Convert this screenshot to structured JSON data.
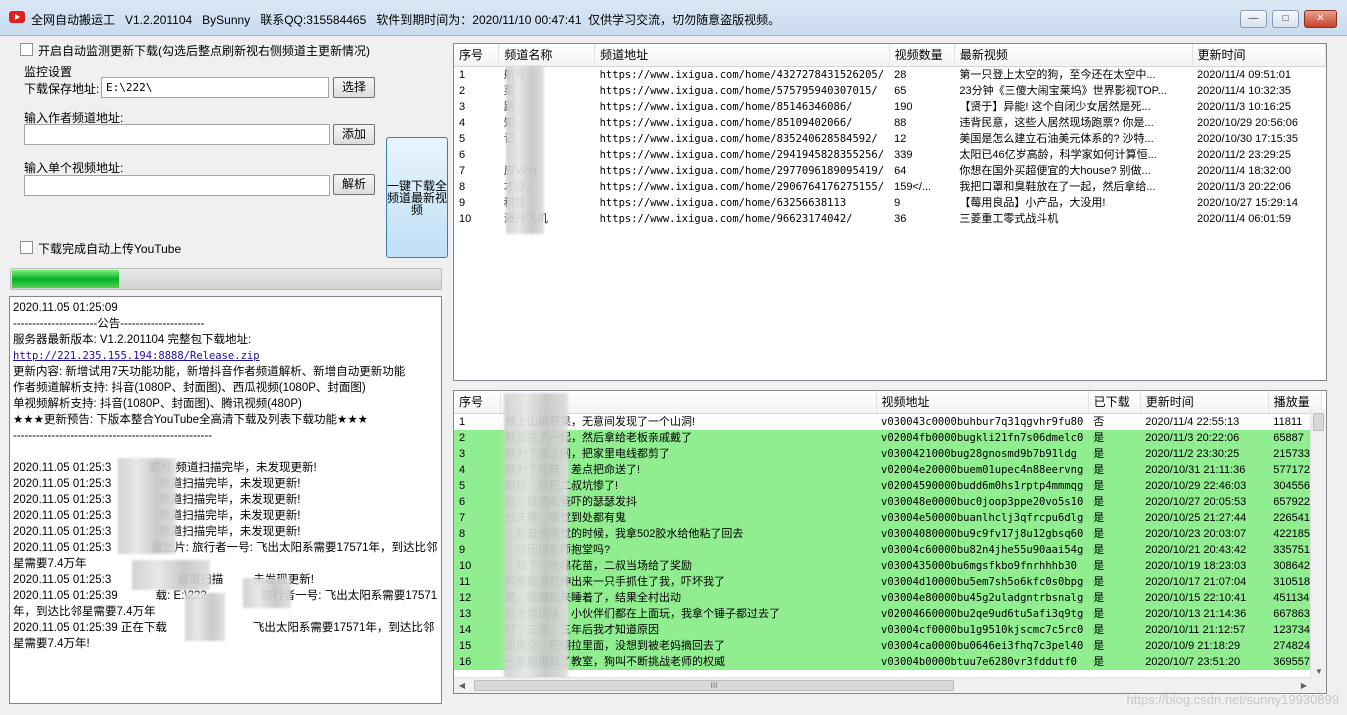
{
  "window": {
    "title": "全网自动搬运工   V1.2.201104   BySunny   联系QQ:315584465   软件到期时间为：2020/11/10 00:47:41  仅供学习交流，切勿随意盗版视频。",
    "minimize": "—",
    "maximize": "□",
    "close": "✕"
  },
  "left": {
    "auto_monitor_label": "开启自动监测更新下载(勾选后整点刷新视右侧频道主更新情况)",
    "auto_monitor_checked": false,
    "monitor_settings": "监控设置",
    "save_path_label": "下载保存地址:",
    "save_path_value": "E:\\222\\",
    "choose_button": "选择",
    "author_channel_label": "输入作者频道地址:",
    "author_channel_value": "",
    "add_button": "添加",
    "single_video_label": "输入单个视频地址:",
    "single_video_value": "",
    "parse_button": "解析",
    "download_all_button": "一键下载全频道最新视频",
    "auto_upload_label": "下载完成自动上传YouTube",
    "auto_upload_checked": false,
    "progress": 0.25,
    "colors": {
      "progress": "#06b025",
      "row_highlight": "#90ee90",
      "link": "#1a0dab"
    }
  },
  "log": {
    "line1": "2020.11.05 01:25:09",
    "line2": "----------------------公告----------------------",
    "line3": "服务器最新版本: V1.2.201104 完整包下载地址:",
    "link": "http://221.235.155.194:8888/Release.zip",
    "line5": "更新内容: 新增试用7天功能功能，新增抖音作者频道解析、新增自动更新功能",
    "line6": "作者频道解析支持: 抖音(1080P、封面图)、西瓜视频(1080P、封面图)",
    "line7": "单视频解析支持: 抖音(1080P、封面图)、腾讯视频(480P)",
    "line8": "★★★更新预告: 下版本整合YouTube全高清下载及列表下载功能★★★",
    "line9": "----------------------------------------------------",
    "e1": "2020.11.05 01:25:3",
    "e1b": "航号 频道扫描完毕，未发现更新!",
    "e2": "2020.11.05 01:25:3",
    "e2b": "频道扫描完毕，未发现更新!",
    "e3": "2020.11.05 01:25:3",
    "e3b": "频道扫描完毕，未发现更新!",
    "e4": "2020.11.05 01:25:3",
    "e4b": "频道扫描完毕，未发现更新!",
    "e5": "2020.11.05 01:25:3",
    "e5b": "频道扫描完毕，未发现更新!",
    "e6": "2020.11.05 01:25:3",
    "e6b": "截图片: 旅行者一号: 飞出太阳系需要17571年，到达比邻星需要7.4万年",
    "e7": "2020.11.05 01:25:3",
    "e7b": "频道扫描",
    "e7c": "未发现更新!",
    "e8": "2020.11.05 01:25:39",
    "e8b": "载: E:\\222",
    "e8c": "旅行者一号: 飞出太阳系需要17571年，到达比邻星需要7.4万年",
    "e9": "2020.11.05 01:25:39 正在下载",
    "e9b": "飞出太阳系需要17571年，到达比邻星需要7.4万年!"
  },
  "channels": {
    "headers": [
      "序号",
      "频道名称",
      "频道地址",
      "视频数量",
      "最新视频",
      "更新时间"
    ],
    "rows": [
      [
        "1",
        "航号",
        "https://www.ixigua.com/home/4327278431526205/",
        "28",
        "第一只登上太空的狗，至今还在太空中...",
        "2020/11/4 09:51:01"
      ],
      [
        "2",
        "菜",
        "https://www.ixigua.com/home/575795940307015/",
        "65",
        "23分钟《三傻大闹宝莱坞》世界影视TOP...",
        "2020/11/4 10:32:35"
      ],
      [
        "3",
        "路",
        "https://www.ixigua.com/home/85146346086/",
        "190",
        "【贤于】异能! 这个自闭少女居然是死...",
        "2020/11/3 10:16:25"
      ],
      [
        "4",
        "知",
        "https://www.ixigua.com/home/85109402066/",
        "88",
        "违背民意，这些人居然现场跑票? 你是...",
        "2020/10/29 20:56:06"
      ],
      [
        "5",
        "记",
        "https://www.ixigua.com/home/835240628584592/",
        "12",
        "美国是怎么建立石油美元体系的? 沙特...",
        "2020/10/30 17:15:35"
      ],
      [
        "6",
        "",
        "https://www.ixigua.com/home/2941945828355256/",
        "339",
        "太阳已46亿岁高龄，科学家如何计算恒...",
        "2020/11/2 23:29:25"
      ],
      [
        "7",
        "房Vlog",
        "https://www.ixigua.com/home/2977096189095419/",
        "64",
        "你想在国外买超便宜的大house? 别做...",
        "2020/11/4 18:32:00"
      ],
      [
        "8",
        "才沙...",
        "https://www.ixigua.com/home/2906764176275155/",
        "159</...",
        "我把口罩和臭鞋放在了一起，然后拿给...",
        "2020/11/3 20:22:06"
      ],
      [
        "9",
        "科技",
        "https://www.ixigua.com/home/63256638113",
        "9",
        "【莓用良品】小产品，大没用!",
        "2020/10/27 15:29:14"
      ],
      [
        "10",
        "海开飞机",
        "https://www.ixigua.com/home/96623174042/",
        "36",
        "三菱重工零式战斗机",
        "2020/11/4 06:01:59"
      ]
    ]
  },
  "videos": {
    "headers": [
      "序号",
      "",
      "视频地址",
      "已下载",
      "更新时间",
      "播放量"
    ],
    "rows": [
      [
        "1",
        "候上山摘野果，无意间发现了一个山洞!",
        "v030043c0000buhbur7q31qgvhr9fu80",
        "否",
        "2020/11/4 22:55:13",
        "11811"
      ],
      [
        "2",
        "鞋放在了一起，然后拿给老板亲戚戴了",
        "v02004fb0000bugkli21fn7s06dmelc0",
        "是",
        "2020/11/3 20:22:06",
        "65887"
      ],
      [
        "3",
        "候为了去上网，把家里电线都剪了",
        "v0300421000bug28gnosmd9b7b91ldg",
        "是",
        "2020/11/2 23:30:25",
        "215733"
      ],
      [
        "4",
        "候为了吃糖，差点把命送了!",
        "v02004e20000buem01upec4n88eervng",
        "是",
        "2020/10/31 21:11:36",
        "577172"
      ],
      [
        "5",
        "摩托，就把二叔坑惨了!",
        "v02004590000budd6m0hs1rptp4mmmqg",
        "是",
        "2020/10/29 22:46:03",
        "304556"
      ],
      [
        "6",
        "后，就把老爸吓的瑟瑟发抖",
        "v030048e0000buc0joop3ppe20vo5s10",
        "是",
        "2020/10/27 20:05:53",
        "657922"
      ],
      [
        "7",
        "分床睡，感觉到处都有鬼",
        "v03004e50000buanlhclj3qfrcpu6dlg",
        "是",
        "2020/10/25 21:27:44",
        "226541"
      ],
      [
        "8",
        "，趁着他睡觉的时候，我拿502胶水给他粘了回去",
        "v03004080000bu9c9fv17j8u12gbsq60",
        "是",
        "2020/10/23 20:03:07",
        "422185"
      ],
      [
        "9",
        "，经历过老师抱堂吗?",
        "v03004c60000bu82n4jhe55u90aai54g",
        "是",
        "2020/10/21 20:43:42",
        "335751"
      ],
      [
        "10",
        "，拔了一地棉花苗，二叔当场给了奖励",
        "v0300435000bu6mgsfkbo9fnrhhhb30",
        "是",
        "2020/10/19 18:23:03",
        "308642"
      ],
      [
        "11",
        "同里面突然伸出来一只手抓住了我，吓坏我了",
        "v03004d10000bu5em7sh5o6kfc0s0bpg",
        "是",
        "2020/10/17 21:07:04",
        "310518"
      ],
      [
        "12",
        "藏，我藏起来睡着了，结果全村出动",
        "v03004e80000bu45g2uladgntrbsnalg",
        "是",
        "2020/10/15 22:10:41",
        "451134"
      ],
      [
        "13",
        "后池塘结冰，小伙伴们都在上面玩，我拿个锤子都过去了",
        "v02004660000bu2qe9ud6tu5afi3q9tg",
        "是",
        "2020/10/13 21:14:36",
        "667863"
      ],
      [
        "14",
        "打了三天，三年后我才知道原因",
        "v03004cf0000bu1g9510kjscmc7c5rc0",
        "是",
        "2020/10/11 21:12:57",
        "1237340"
      ],
      [
        "15",
        "瓜掏空，把翔拉里面，没想到被老妈摘回去了",
        "v03004ca0000bu0646ei3fhq7c3pel40",
        "是",
        "2020/10/9 21:18:29",
        "274824"
      ],
      [
        "16",
        "一条狗带到了教室，狗叫不断挑战老师的权威",
        "v03004b0000btuu7e6280vr3fddutf0",
        "是",
        "2020/10/7 23:51:20",
        "369557"
      ]
    ],
    "hscroll_label": "III"
  },
  "watermark": "https://blog.csdn.net/sunny19930899"
}
